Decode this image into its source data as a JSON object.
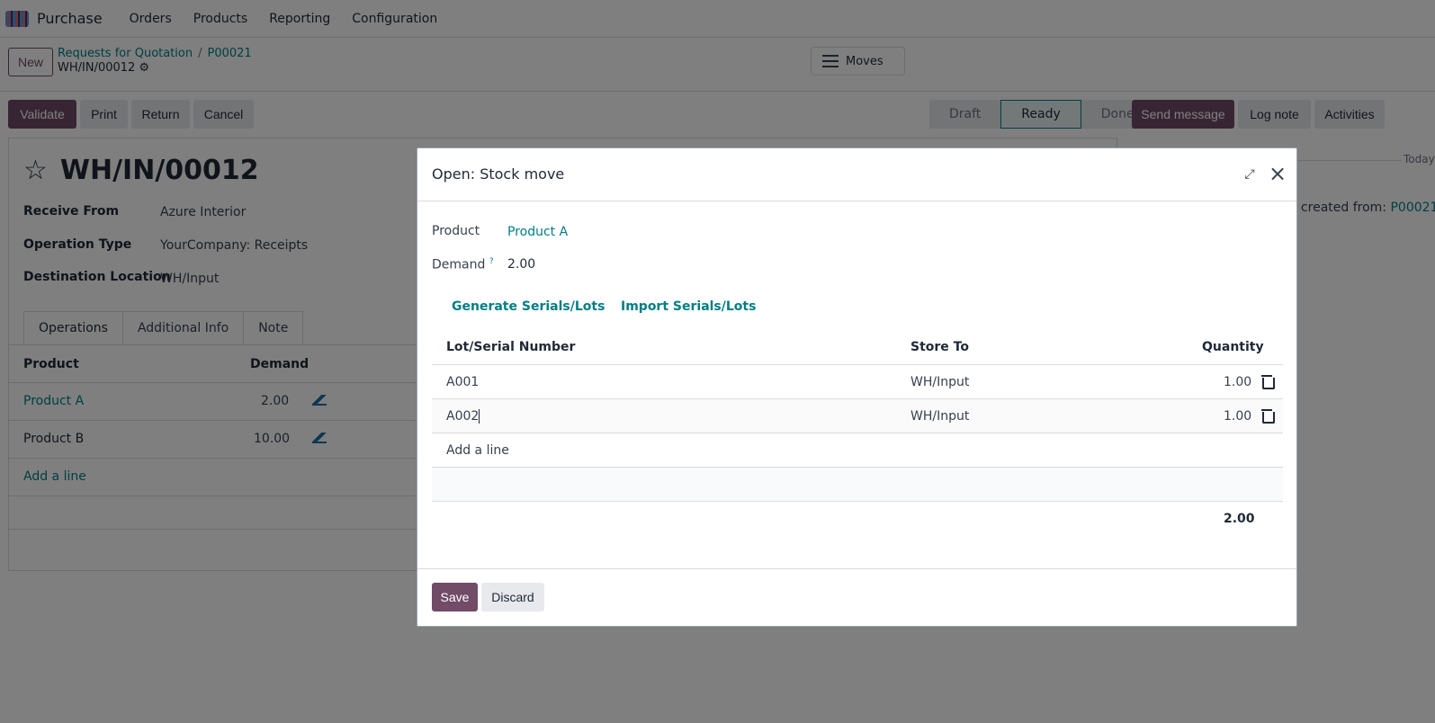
{
  "navbar": {
    "app_name": "Purchase",
    "menus": [
      "Orders",
      "Products",
      "Reporting",
      "Configuration"
    ]
  },
  "control_panel": {
    "new_label": "New",
    "breadcrumb": [
      "Requests for Quotation",
      "P00021"
    ],
    "breadcrumb_sep": "/",
    "record_name": "WH/IN/00012",
    "moves_label": "Moves"
  },
  "actions": {
    "validate": "Validate",
    "print": "Print",
    "return": "Return",
    "cancel": "Cancel"
  },
  "stages": [
    "Draft",
    "Ready",
    "Done"
  ],
  "current_stage": "Ready",
  "chatter": {
    "send_message": "Send message",
    "log_note": "Log note",
    "activities": "Activities",
    "today": "Today",
    "message_text": "en created from: ",
    "message_link": "P00021"
  },
  "form": {
    "title": "WH/IN/00012",
    "fields": [
      {
        "label": "Receive From",
        "value": "Azure Interior"
      },
      {
        "label": "Operation Type",
        "value": "YourCompany: Receipts"
      },
      {
        "label": "Destination Location",
        "value": "WH/Input"
      }
    ],
    "tabs": [
      "Operations",
      "Additional Info",
      "Note"
    ],
    "columns": {
      "product": "Product",
      "demand": "Demand"
    },
    "rows": [
      {
        "product": "Product A",
        "demand": "2.00"
      },
      {
        "product": "Product B",
        "demand": "10.00"
      }
    ],
    "add_line": "Add a line"
  },
  "modal": {
    "title": "Open: Stock move",
    "product_label": "Product",
    "product_value": "Product A",
    "demand_label": "Demand",
    "demand_help": "?",
    "demand_value": "2.00",
    "generate_btn": "Generate Serials/Lots",
    "import_btn": "Import Serials/Lots",
    "columns": {
      "lot": "Lot/Serial Number",
      "store": "Store To",
      "qty": "Quantity"
    },
    "lines": [
      {
        "lot": "A001",
        "store": "WH/Input",
        "qty": "1.00"
      },
      {
        "lot": "A002",
        "store": "WH/Input",
        "qty": "1.00"
      }
    ],
    "add_line": "Add a line",
    "total": "2.00",
    "save": "Save",
    "discard": "Discard"
  }
}
